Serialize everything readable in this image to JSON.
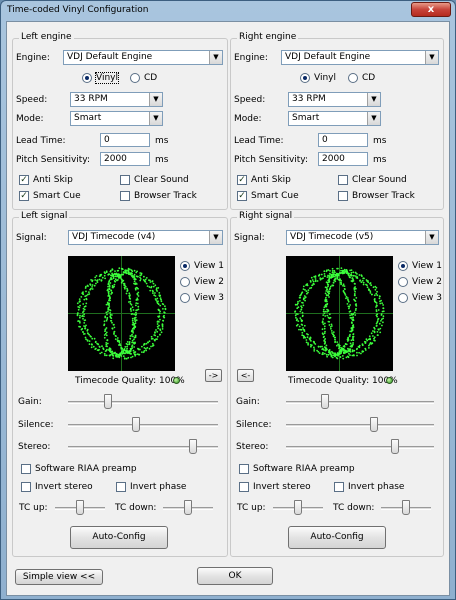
{
  "window": {
    "title": "Time-coded Vinyl Configuration",
    "close_glyph": "x"
  },
  "left_engine": {
    "group_label": "Left engine",
    "engine_label": "Engine:",
    "engine_value": "VDJ Default Engine",
    "vinyl_label": "Vinyl",
    "cd_label": "CD",
    "selected_media": "Vinyl",
    "speed_label": "Speed:",
    "speed_value": "33 RPM",
    "mode_label": "Mode:",
    "mode_value": "Smart",
    "lead_time_label": "Lead Time:",
    "lead_time_value": "0",
    "lead_time_unit": "ms",
    "pitch_sens_label": "Pitch Sensitivity:",
    "pitch_sens_value": "2000",
    "pitch_sens_unit": "ms",
    "anti_skip_label": "Anti Skip",
    "anti_skip_checked": true,
    "clear_sound_label": "Clear Sound",
    "clear_sound_checked": false,
    "smart_cue_label": "Smart Cue",
    "smart_cue_checked": true,
    "browser_track_label": "Browser Track",
    "browser_track_checked": false
  },
  "right_engine": {
    "group_label": "Right engine",
    "engine_label": "Engine:",
    "engine_value": "VDJ Default Engine",
    "vinyl_label": "Vinyl",
    "cd_label": "CD",
    "selected_media": "Vinyl",
    "speed_label": "Speed:",
    "speed_value": "33 RPM",
    "mode_label": "Mode:",
    "mode_value": "Smart",
    "lead_time_label": "Lead Time:",
    "lead_time_value": "0",
    "lead_time_unit": "ms",
    "pitch_sens_label": "Pitch Sensitivity:",
    "pitch_sens_value": "2000",
    "pitch_sens_unit": "ms",
    "anti_skip_label": "Anti Skip",
    "anti_skip_checked": true,
    "clear_sound_label": "Clear Sound",
    "clear_sound_checked": false,
    "smart_cue_label": "Smart Cue",
    "smart_cue_checked": true,
    "browser_track_label": "Browser Track",
    "browser_track_checked": false
  },
  "left_signal": {
    "group_label": "Left signal",
    "signal_label": "Signal:",
    "signal_value": "VDJ Timecode (v4)",
    "view1_label": "View 1",
    "view2_label": "View 2",
    "view3_label": "View 3",
    "selected_view": "View 1",
    "quality_label": "Timecode Quality: 100%",
    "copy_button": "->",
    "gain_label": "Gain:",
    "gain_level": 0.25,
    "silence_label": "Silence:",
    "silence_level": 0.45,
    "stereo_label": "Stereo:",
    "stereo_level": 0.85,
    "riaa_label": "Software RIAA preamp",
    "invert_stereo_label": "Invert stereo",
    "invert_phase_label": "Invert phase",
    "tc_up_label": "TC up:",
    "tc_up_level": 0.5,
    "tc_down_label": "TC down:",
    "tc_down_level": 0.5,
    "auto_config_label": "Auto-Config"
  },
  "right_signal": {
    "group_label": "Right signal",
    "signal_label": "Signal:",
    "signal_value": "VDJ Timecode (v5)",
    "view1_label": "View 1",
    "view2_label": "View 2",
    "view3_label": "View 3",
    "selected_view": "View 1",
    "quality_label": "Timecode Quality: 100%",
    "copy_button": "<-",
    "gain_label": "Gain:",
    "gain_level": 0.25,
    "silence_label": "Silence:",
    "silence_level": 0.6,
    "stereo_label": "Stereo:",
    "stereo_level": 0.75,
    "riaa_label": "Software RIAA preamp",
    "invert_stereo_label": "Invert stereo",
    "invert_phase_label": "Invert phase",
    "tc_up_label": "TC up:",
    "tc_up_level": 0.5,
    "tc_down_label": "TC down:",
    "tc_down_level": 0.5,
    "auto_config_label": "Auto-Config"
  },
  "footer": {
    "simple_view_label": "Simple view <<",
    "ok_label": "OK"
  },
  "colors": {
    "scope_trace": "#3cff3c",
    "scope_bg": "#000000"
  }
}
